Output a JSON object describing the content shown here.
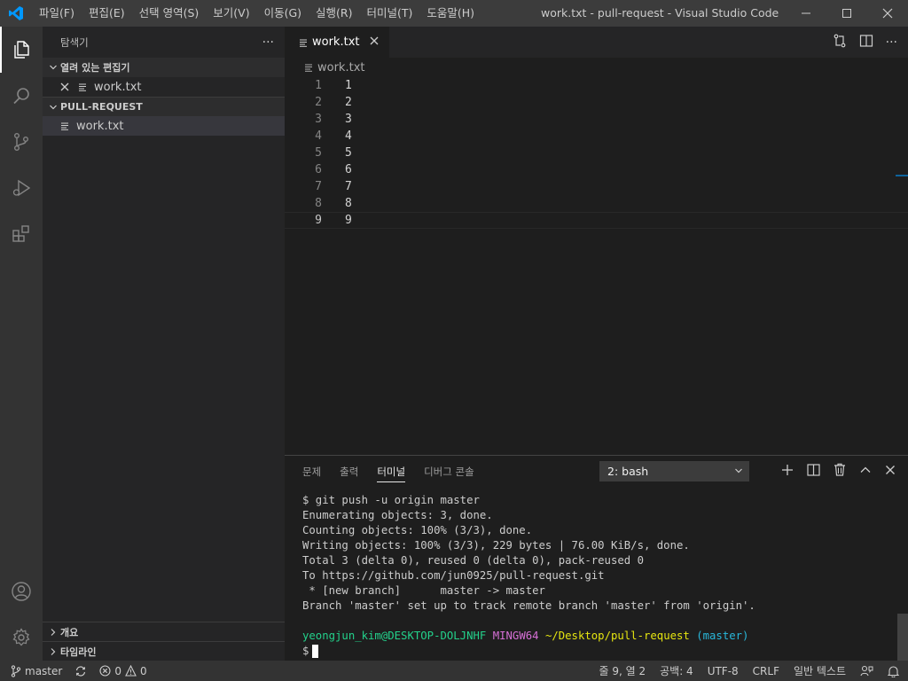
{
  "titlebar": {
    "menus": [
      "파일(F)",
      "편집(E)",
      "선택 영역(S)",
      "보기(V)",
      "이동(G)",
      "실행(R)",
      "터미널(T)",
      "도움말(H)"
    ],
    "title": "work.txt - pull-request - Visual Studio Code"
  },
  "sidebar": {
    "header": "탐색기",
    "more": "···",
    "open_editors_label": "열려 있는 편집기",
    "open_editor_file": "work.txt",
    "folder_label": "PULL-REQUEST",
    "folder_file": "work.txt",
    "outline_label": "개요",
    "timeline_label": "타임라인"
  },
  "editor": {
    "tab_label": "work.txt",
    "breadcrumb": "work.txt",
    "lines": [
      {
        "num": "1",
        "text": "1"
      },
      {
        "num": "2",
        "text": "2"
      },
      {
        "num": "3",
        "text": "3"
      },
      {
        "num": "4",
        "text": "4"
      },
      {
        "num": "5",
        "text": "5"
      },
      {
        "num": "6",
        "text": "6"
      },
      {
        "num": "7",
        "text": "7"
      },
      {
        "num": "8",
        "text": "8"
      },
      {
        "num": "9",
        "text": "9"
      }
    ]
  },
  "panel": {
    "tabs": [
      "문제",
      "출력",
      "터미널",
      "디버그 콘솔"
    ],
    "terminal_select": "2: bash",
    "terminal_lines": [
      "$ git push -u origin master",
      "Enumerating objects: 3, done.",
      "Counting objects: 100% (3/3), done.",
      "Writing objects: 100% (3/3), 229 bytes | 76.00 KiB/s, done.",
      "Total 3 (delta 0), reused 0 (delta 0), pack-reused 0",
      "To https://github.com/jun0925/pull-request.git",
      " * [new branch]      master -> master",
      "Branch 'master' set up to track remote branch 'master' from 'origin'.",
      ""
    ],
    "prompt_user": "yeongjun_kim@DESKTOP-DOLJNHF",
    "prompt_env": "MINGW64",
    "prompt_path": "~/Desktop/pull-request",
    "prompt_branch": "(master)",
    "prompt_symbol": "$"
  },
  "statusbar": {
    "branch": "master",
    "errors": "0",
    "warnings": "0",
    "position": "줄 9, 열 2",
    "spaces": "공백: 4",
    "encoding": "UTF-8",
    "eol": "CRLF",
    "language": "일반 텍스트"
  },
  "colors": {
    "accent": "#0e639c",
    "titlebar_bg": "#3c3c3c",
    "activitybar_bg": "#333333",
    "sidebar_bg": "#252526",
    "editor_bg": "#1e1e1e",
    "statusbar_bg": "#333333"
  }
}
